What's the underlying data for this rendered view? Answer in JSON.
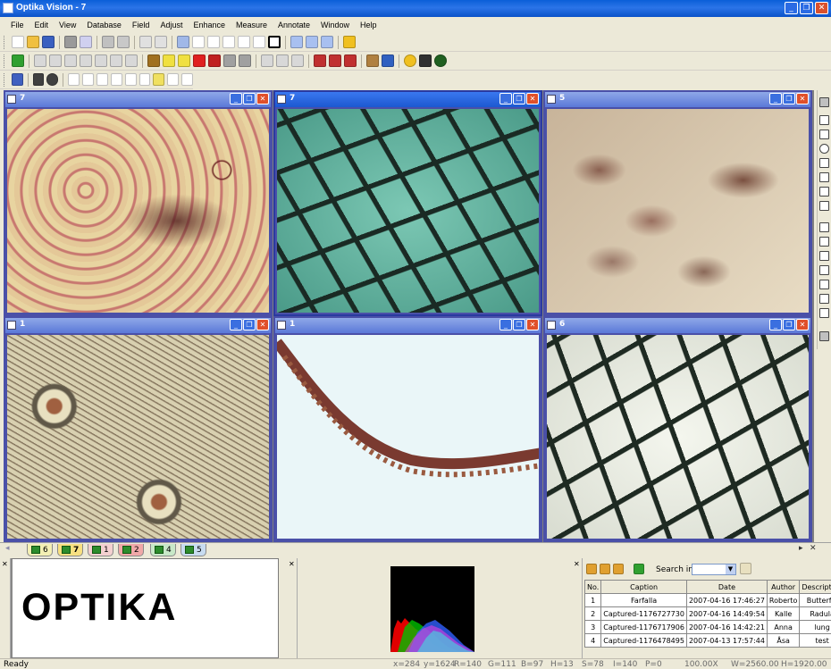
{
  "title": "Optika Vision - 7",
  "menu": [
    "File",
    "Edit",
    "View",
    "Database",
    "Field",
    "Adjust",
    "Enhance",
    "Measure",
    "Annotate",
    "Window",
    "Help"
  ],
  "windows": [
    {
      "name": "7",
      "active": false
    },
    {
      "name": "7",
      "active": true
    },
    {
      "name": "5",
      "active": false
    },
    {
      "name": "1",
      "active": false
    },
    {
      "name": "1",
      "active": false
    },
    {
      "name": "6",
      "active": false
    }
  ],
  "tabs": [
    {
      "label": "6",
      "color": "#f4f0b4"
    },
    {
      "label": "7",
      "color": "#f8e080"
    },
    {
      "label": "1",
      "color": "#f4d0d0"
    },
    {
      "label": "2",
      "color": "#f0a8a8"
    },
    {
      "label": "4",
      "color": "#c8e8c8"
    },
    {
      "label": "5",
      "color": "#c8dcf0"
    }
  ],
  "preview_text": "OPTIKA",
  "search_label": "Search in",
  "table": {
    "headers": [
      "No.",
      "Caption",
      "Date",
      "Author",
      "Description"
    ],
    "rows": [
      [
        "1",
        "Farfalla",
        "2007-04-16 17:46:27",
        "Roberto",
        "Butterfly"
      ],
      [
        "2",
        "Captured-1176727730",
        "2007-04-16 14:49:54",
        "Kalle",
        "Radula"
      ],
      [
        "3",
        "Captured-1176717906",
        "2007-04-16 14:42:21",
        "Anna",
        "lung"
      ],
      [
        "4",
        "Captured-1176478495",
        "2007-04-13 17:57:44",
        "Åsa",
        "test"
      ]
    ]
  },
  "status": {
    "ready": "Ready",
    "x": "x=284",
    "y": "y=1624",
    "r": "R=140",
    "g": "G=111",
    "b": "B=97",
    "h": "H=13",
    "s": "S=78",
    "i": "I=140",
    "p": "P=0",
    "zoom": "100.00X",
    "w": "W=2560.00",
    "hh": "H=1920.00"
  },
  "icons": [
    "new-icon",
    "open-icon",
    "save-icon",
    "print-icon",
    "zoom-icon",
    "help-icon",
    "camera-icon",
    "tile-icon",
    "cascade-icon"
  ]
}
